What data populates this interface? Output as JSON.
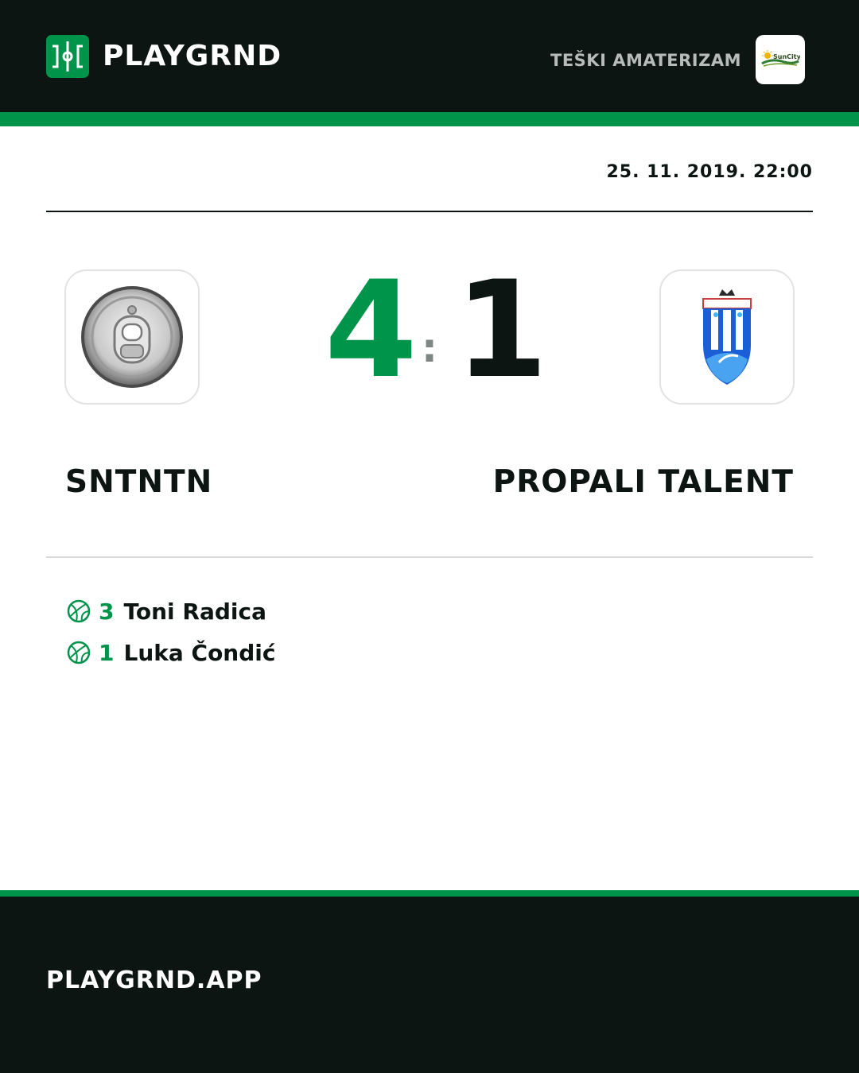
{
  "brand": {
    "name": "PLAYGRND",
    "icon": "pitch-icon"
  },
  "league": {
    "name": "TEŠKI AMATERIZAM",
    "sponsor_logo": "suncity-logo",
    "sponsor_text": "SunCity"
  },
  "match": {
    "datetime": "25. 11. 2019. 22:00",
    "separator": ":",
    "home": {
      "name": "SNTNTN",
      "score": "4",
      "crest": "can-lid-crest"
    },
    "away": {
      "name": "PROPALI TALENT",
      "score": "1",
      "crest": "blue-shield-crest"
    }
  },
  "scorers": [
    {
      "goals": "3",
      "name": "Toni Radica",
      "icon": "ball-icon"
    },
    {
      "goals": "1",
      "name": "Luka Čondić",
      "icon": "ball-icon"
    }
  ],
  "footer": {
    "url": "PLAYGRND.APP"
  },
  "colors": {
    "dark": "#0c1512",
    "accent": "#00934a",
    "muted": "#b7bcba"
  }
}
